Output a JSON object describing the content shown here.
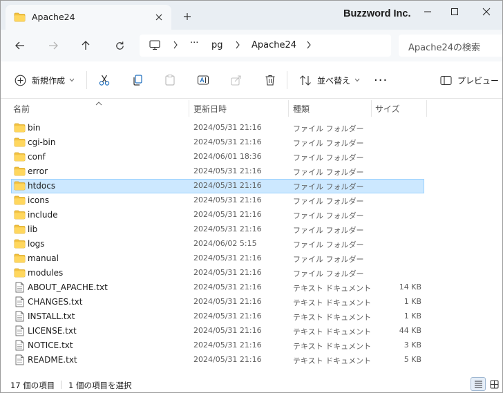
{
  "window": {
    "tab_title": "Apache24",
    "brand": "Buzzword Inc."
  },
  "address": {
    "crumbs": [
      "pg",
      "Apache24"
    ],
    "overflow": "···"
  },
  "search": {
    "placeholder": "Apache24の検索"
  },
  "toolbar": {
    "new_label": "新規作成",
    "sort_label": "並べ替え",
    "more_label": "···",
    "preview_label": "プレビュー"
  },
  "columns": {
    "name": "名前",
    "date": "更新日時",
    "type": "種類",
    "size": "サイズ"
  },
  "files": [
    {
      "name": "bin",
      "date": "2024/05/31 21:16",
      "type": "ファイル フォルダー",
      "size": "",
      "icon": "folder-icon"
    },
    {
      "name": "cgi-bin",
      "date": "2024/05/31 21:16",
      "type": "ファイル フォルダー",
      "size": "",
      "icon": "folder-icon"
    },
    {
      "name": "conf",
      "date": "2024/06/01 18:36",
      "type": "ファイル フォルダー",
      "size": "",
      "icon": "folder-icon"
    },
    {
      "name": "error",
      "date": "2024/05/31 21:16",
      "type": "ファイル フォルダー",
      "size": "",
      "icon": "folder-icon"
    },
    {
      "name": "htdocs",
      "date": "2024/05/31 21:16",
      "type": "ファイル フォルダー",
      "size": "",
      "icon": "folder-icon",
      "selected": true
    },
    {
      "name": "icons",
      "date": "2024/05/31 21:16",
      "type": "ファイル フォルダー",
      "size": "",
      "icon": "folder-icon"
    },
    {
      "name": "include",
      "date": "2024/05/31 21:16",
      "type": "ファイル フォルダー",
      "size": "",
      "icon": "folder-icon"
    },
    {
      "name": "lib",
      "date": "2024/05/31 21:16",
      "type": "ファイル フォルダー",
      "size": "",
      "icon": "folder-icon"
    },
    {
      "name": "logs",
      "date": "2024/06/02 5:15",
      "type": "ファイル フォルダー",
      "size": "",
      "icon": "folder-icon"
    },
    {
      "name": "manual",
      "date": "2024/05/31 21:16",
      "type": "ファイル フォルダー",
      "size": "",
      "icon": "folder-icon"
    },
    {
      "name": "modules",
      "date": "2024/05/31 21:16",
      "type": "ファイル フォルダー",
      "size": "",
      "icon": "folder-icon"
    },
    {
      "name": "ABOUT_APACHE.txt",
      "date": "2024/05/31 21:16",
      "type": "テキスト ドキュメント",
      "size": "14 KB",
      "icon": "text-file-icon"
    },
    {
      "name": "CHANGES.txt",
      "date": "2024/05/31 21:16",
      "type": "テキスト ドキュメント",
      "size": "1 KB",
      "icon": "text-file-icon"
    },
    {
      "name": "INSTALL.txt",
      "date": "2024/05/31 21:16",
      "type": "テキスト ドキュメント",
      "size": "1 KB",
      "icon": "text-file-icon"
    },
    {
      "name": "LICENSE.txt",
      "date": "2024/05/31 21:16",
      "type": "テキスト ドキュメント",
      "size": "44 KB",
      "icon": "text-file-icon"
    },
    {
      "name": "NOTICE.txt",
      "date": "2024/05/31 21:16",
      "type": "テキスト ドキュメント",
      "size": "3 KB",
      "icon": "text-file-icon"
    },
    {
      "name": "README.txt",
      "date": "2024/05/31 21:16",
      "type": "テキスト ドキュメント",
      "size": "5 KB",
      "icon": "text-file-icon"
    }
  ],
  "status": {
    "item_count": "17 個の項目",
    "selection": "1 個の項目を選択"
  },
  "colors": {
    "folder": "#f3c343",
    "selection_bg": "#cce8ff",
    "selection_border": "#99d1ff",
    "titlebar_bg": "#e9eef3"
  }
}
